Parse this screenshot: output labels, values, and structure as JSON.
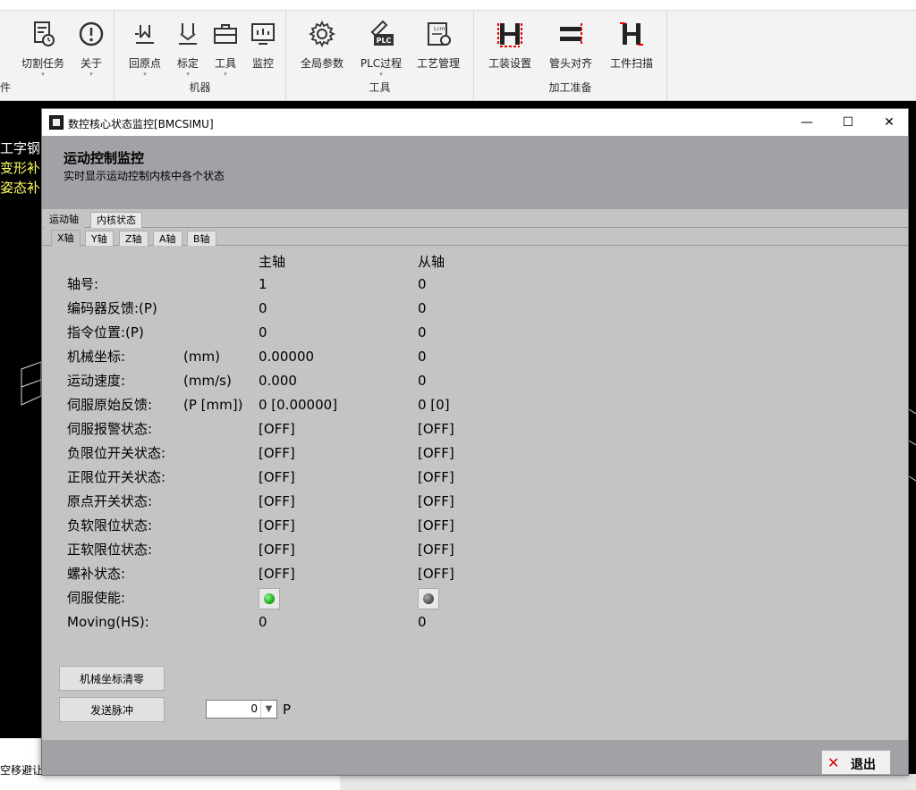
{
  "ribbon": {
    "groups": [
      {
        "label": "件",
        "buttons": [
          {
            "label": "]"
          }
        ]
      },
      {
        "label": "",
        "buttons": [
          {
            "label": "切割任务",
            "icon": "task-clock-icon"
          },
          {
            "label": "关于",
            "icon": "info-icon"
          }
        ]
      },
      {
        "label": "机器",
        "buttons": [
          {
            "label": "回原点",
            "icon": "home-axis-icon"
          },
          {
            "label": "标定",
            "icon": "calibrate-icon"
          },
          {
            "label": "工具",
            "icon": "toolbox-icon"
          },
          {
            "label": "监控",
            "icon": "monitor-icon"
          }
        ]
      },
      {
        "label": "工具",
        "buttons": [
          {
            "label": "全局参数",
            "icon": "gear-icon"
          },
          {
            "label": "PLC过程",
            "icon": "plc-icon"
          },
          {
            "label": "工艺管理",
            "icon": "process-icon"
          }
        ]
      },
      {
        "label": "加工准备",
        "buttons": [
          {
            "label": "工装设置",
            "icon": "fixture-icon"
          },
          {
            "label": "管头对齐",
            "icon": "tube-align-icon"
          },
          {
            "label": "工件扫描",
            "icon": "workpiece-scan-icon"
          }
        ]
      }
    ]
  },
  "background": {
    "cad_lines": [
      {
        "text": "工字钢",
        "color": "#ffffff"
      },
      {
        "text": "变形补",
        "color": "#ffff66"
      },
      {
        "text": "姿态补",
        "color": "#ffff66"
      }
    ],
    "status_text": "空移避让"
  },
  "dialog": {
    "title": "数控核心状态监控[BMCSIMU]",
    "header_title": "运动控制监控",
    "header_subtitle": "实时显示运动控制内核中各个状态",
    "tabs_top": [
      "运动轴",
      "内核状态"
    ],
    "tabs_axis": [
      "X轴",
      "Y轴",
      "Z轴",
      "A轴",
      "B轴"
    ],
    "columns": {
      "master": "主轴",
      "slave": "从轴"
    },
    "rows": [
      {
        "label": "轴号:",
        "unit": "",
        "master": "1",
        "slave": "0"
      },
      {
        "label": "编码器反馈:(P)",
        "unit": "",
        "master": "0",
        "slave": "0"
      },
      {
        "label": "指令位置:(P)",
        "unit": "",
        "master": "0",
        "slave": "0"
      },
      {
        "label": "机械坐标:",
        "unit": "(mm)",
        "master": "0.00000",
        "slave": "0"
      },
      {
        "label": "运动速度:",
        "unit": "(mm/s)",
        "master": "0.000",
        "slave": "0"
      },
      {
        "label": "伺服原始反馈:",
        "unit": "(P [mm])",
        "master": "0 [0.00000]",
        "slave": "0 [0]"
      },
      {
        "label": "伺服报警状态:",
        "unit": "",
        "master": "[OFF]",
        "slave": "[OFF]"
      },
      {
        "label": "负限位开关状态:",
        "unit": "",
        "master": "[OFF]",
        "slave": "[OFF]"
      },
      {
        "label": "正限位开关状态:",
        "unit": "",
        "master": "[OFF]",
        "slave": "[OFF]"
      },
      {
        "label": "原点开关状态:",
        "unit": "",
        "master": "[OFF]",
        "slave": "[OFF]"
      },
      {
        "label": "负软限位状态:",
        "unit": "",
        "master": "[OFF]",
        "slave": "[OFF]"
      },
      {
        "label": "正软限位状态:",
        "unit": "",
        "master": "[OFF]",
        "slave": "[OFF]"
      },
      {
        "label": "螺补状态:",
        "unit": "",
        "master": "[OFF]",
        "slave": "[OFF]"
      },
      {
        "label": "伺服使能:",
        "unit": "",
        "master_led": "on",
        "slave_led": "off"
      },
      {
        "label": "Moving(HS):",
        "unit": "",
        "master": "0",
        "slave": "0"
      }
    ],
    "buttons": {
      "zero_coords": "机械坐标清零",
      "send_pulse": "发送脉冲",
      "exit": "退出"
    },
    "pulse": {
      "value": "0",
      "unit": "P"
    },
    "colors": {
      "led_on": "#1fae1f",
      "led_off": "#555555",
      "exit_icon": "#dd0000"
    }
  }
}
